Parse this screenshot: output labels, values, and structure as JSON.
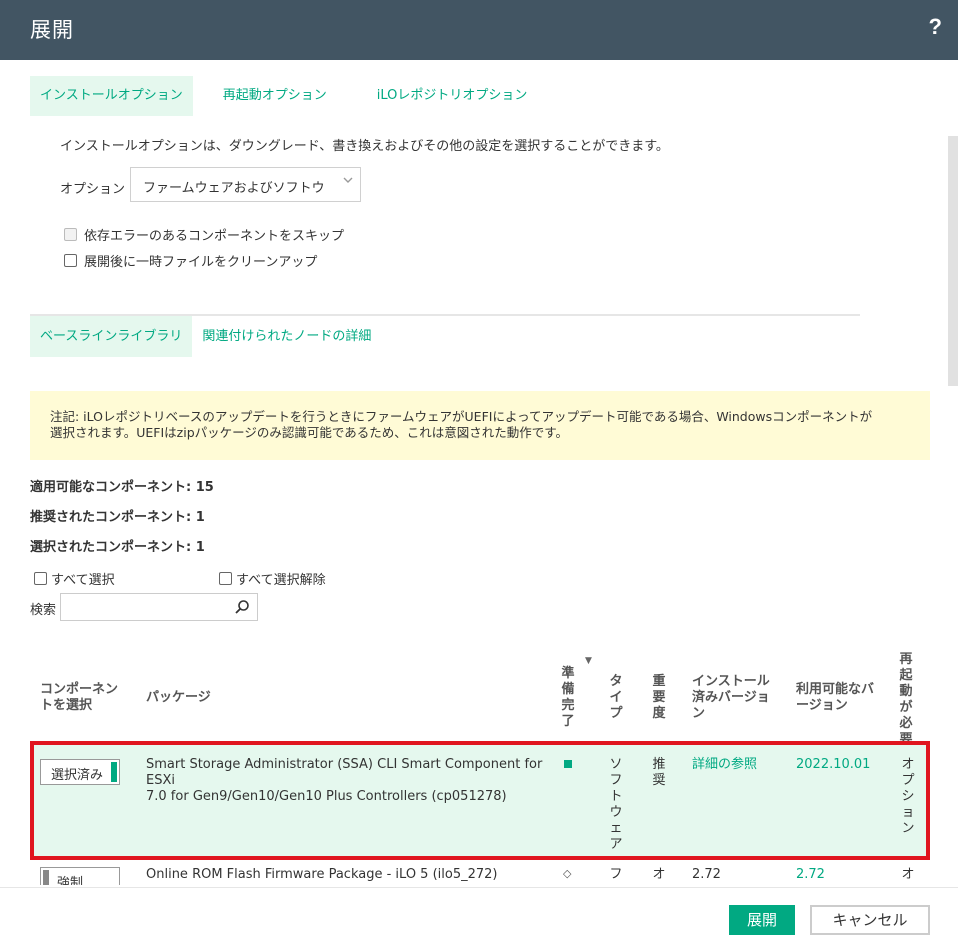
{
  "header": {
    "title": "展開",
    "help": "?"
  },
  "install_tabs": [
    {
      "label": "インストールオプション",
      "active": true
    },
    {
      "label": "再起動オプション",
      "active": false
    },
    {
      "label": "iLOレポジトリオプション",
      "active": false
    }
  ],
  "description": "インストールオプションは、ダウングレード、書き換えおよびその他の設定を選択することができます。",
  "options": {
    "label": "オプション",
    "value": "ファームウェアおよびソフトウ"
  },
  "checkboxes": [
    {
      "label": "依存エラーのあるコンポーネントをスキップ",
      "checked": false,
      "disabled": true
    },
    {
      "label": "展開後に一時ファイルをクリーンアップ",
      "checked": false,
      "disabled": false
    }
  ],
  "baseline_tabs": [
    {
      "label": "ベースラインライブラリ",
      "active": true
    },
    {
      "label": "関連付けられたノードの詳細",
      "active": false
    }
  ],
  "note": {
    "line1": "注記: iLOレポジトリベースのアップデートを行うときにファームウェアがUEFIによってアップデート可能である場合、Windowsコンポーネントが",
    "line2": "選択されます。UEFIはzipパッケージのみ認識可能であるため、これは意図された動作です。"
  },
  "counts": {
    "applicable": "適用可能なコンポーネント: 15",
    "recommended": "推奨されたコンポーネント: 1",
    "selected": "選択されたコンポーネント: 1"
  },
  "select_all": "すべて選択",
  "deselect_all": "すべて選択解除",
  "search": {
    "label": "検索",
    "placeholder": ""
  },
  "table": {
    "headers": {
      "select": [
        "コンポーネン",
        "トを選択"
      ],
      "package": "パッケージ",
      "ready": "準備完了",
      "type": "タイプ",
      "importance": "重要度",
      "installed": [
        "インストール",
        "済みバージョ",
        "ン"
      ],
      "available": [
        "利用可能なバ",
        "ージョン"
      ],
      "reboot": "再起動が必要"
    },
    "rows": [
      {
        "button": "選択済み",
        "package_line1": "Smart Storage Administrator (SSA) CLI Smart Component for ESXi",
        "package_line2": "7.0 for Gen9/Gen10/Gen10 Plus Controllers (cp051278)",
        "type": "ソフトウェア",
        "importance": "推奨",
        "installed": "詳細の参照",
        "available": "2022.10.01",
        "reboot": "オプション",
        "selected": true
      },
      {
        "button": "強制",
        "package_line1": "Online ROM Flash Firmware Package - iLO 5 (ilo5_272)",
        "type": "フ",
        "importance": "オ",
        "installed": "2.72",
        "available": "2.72",
        "reboot": "オ",
        "selected": false
      }
    ]
  },
  "footer": {
    "deploy": "展開",
    "cancel": "キャンセル"
  },
  "colors": {
    "header": "#425563",
    "accent": "#01a982",
    "highlight": "#e5f8ee",
    "note_bg": "#fffbd6",
    "selection_outline": "#e0161f"
  }
}
